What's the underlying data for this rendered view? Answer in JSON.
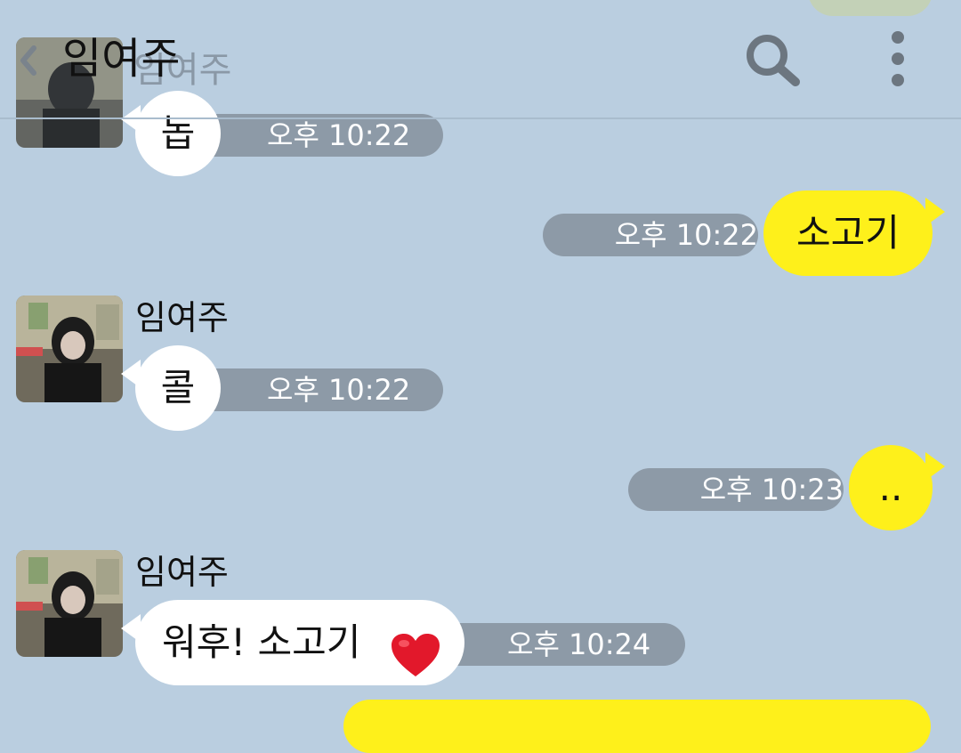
{
  "header": {
    "title": "임여주",
    "ghost_name": "임여주"
  },
  "messages": [
    {
      "id": "m1",
      "direction": "incoming",
      "text": "놉",
      "time": "오후 10:22"
    },
    {
      "id": "m2",
      "direction": "outgoing",
      "text": "소고기",
      "time": "오후 10:22"
    },
    {
      "id": "m3",
      "direction": "incoming",
      "sender": "임여주",
      "text": "콜",
      "time": "오후 10:22"
    },
    {
      "id": "m4",
      "direction": "outgoing",
      "text": "..",
      "time": "오후 10:23"
    },
    {
      "id": "m5",
      "direction": "incoming",
      "sender": "임여주",
      "text": "워후! 소고기",
      "emoji": "heart",
      "time": "오후 10:24"
    }
  ],
  "colors": {
    "chat_background": "#bacee0",
    "incoming_bubble": "#ffffff",
    "outgoing_bubble": "#fef01b",
    "time_pill": "#8d9aa7"
  },
  "icons": {
    "back": "chevron-left-icon",
    "search": "search-icon",
    "more": "more-vertical-icon",
    "heart": "heart-icon"
  }
}
